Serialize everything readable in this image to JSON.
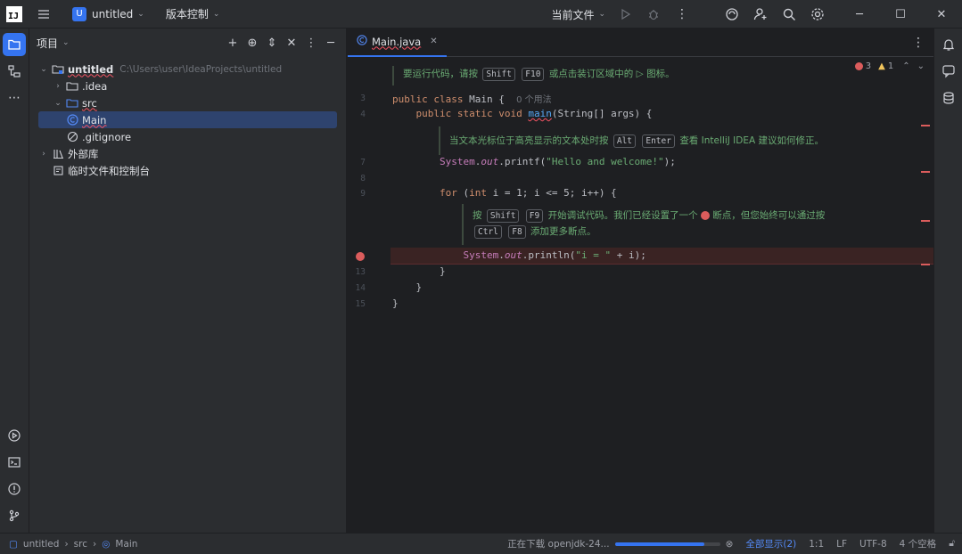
{
  "titlebar": {
    "project_badge": "U",
    "project_name": "untitled",
    "vcs_label": "版本控制",
    "run_config": "当前文件"
  },
  "project_panel": {
    "title": "项目",
    "tree": {
      "root_name": "untitled",
      "root_path": "C:\\Users\\user\\IdeaProjects\\untitled",
      "idea_folder": ".idea",
      "src_folder": "src",
      "main_file": "Main",
      "gitignore": ".gitignore",
      "external_libs": "外部库",
      "scratches": "临时文件和控制台"
    }
  },
  "editor": {
    "tab_label": "Main.java",
    "inspections": {
      "errors": "3",
      "warnings": "1"
    },
    "tip_run": {
      "prefix": "要运行代码，请按",
      "key1": "Shift",
      "key2": "F10",
      "suffix": "或点击装订区域中的",
      "suffix2": "图标。"
    },
    "tip_show": {
      "prefix": "当文本光标位于高亮显示的文本处时按",
      "key1": "Alt",
      "key2": "Enter",
      "suffix": "查看 IntelliJ IDEA 建议如何修正。"
    },
    "tip_debug": {
      "prefix": "按",
      "key1": "Shift",
      "key2": "F9",
      "middle": "开始调试代码。我们已经设置了一个",
      "suffix": "断点，但您始终可以通过按",
      "key3": "Ctrl",
      "key4": "F8",
      "end": "添加更多断点。"
    },
    "usage_hint": "0 个用法",
    "lines": {
      "n3": "3",
      "n4": "4",
      "n7": "7",
      "n8": "8",
      "n9": "9",
      "n12": "12",
      "n13": "13",
      "n14": "14",
      "n15": "15"
    },
    "code": {
      "class_decl_kw": "public class ",
      "class_name": "Main",
      "class_brace": " {",
      "main_kw": "public static void ",
      "main_fn": "main",
      "main_args": "(String[] args) {",
      "printf_cls": "System",
      "printf_dot": ".",
      "printf_fld": "out",
      "printf_call": ".printf(",
      "printf_str": "\"Hello and welcome!\"",
      "printf_end": ");",
      "for_kw": "for",
      "for_paren": " (",
      "for_int": "int",
      "for_rest": " i = 1; i <= 5; i++) {",
      "println_cls": "System",
      "println_fld": "out",
      "println_call": ".println(",
      "println_str": "\"i = \"",
      "println_end": " + i);",
      "close_for": "}",
      "close_main": "}",
      "close_class": "}"
    }
  },
  "statusbar": {
    "crumb_project": "untitled",
    "crumb_src": "src",
    "crumb_main": "Main",
    "progress_label": "正在下载 openjdk-24...",
    "progress_fraction": 0.85,
    "show_all": "全部显示(2)",
    "position": "1:1",
    "line_sep": "LF",
    "encoding": "UTF-8",
    "indent": "4 个空格"
  },
  "colors": {
    "accent": "#3574f0",
    "error": "#db5c5c",
    "string": "#6aab73",
    "keyword": "#cf8e6d"
  }
}
